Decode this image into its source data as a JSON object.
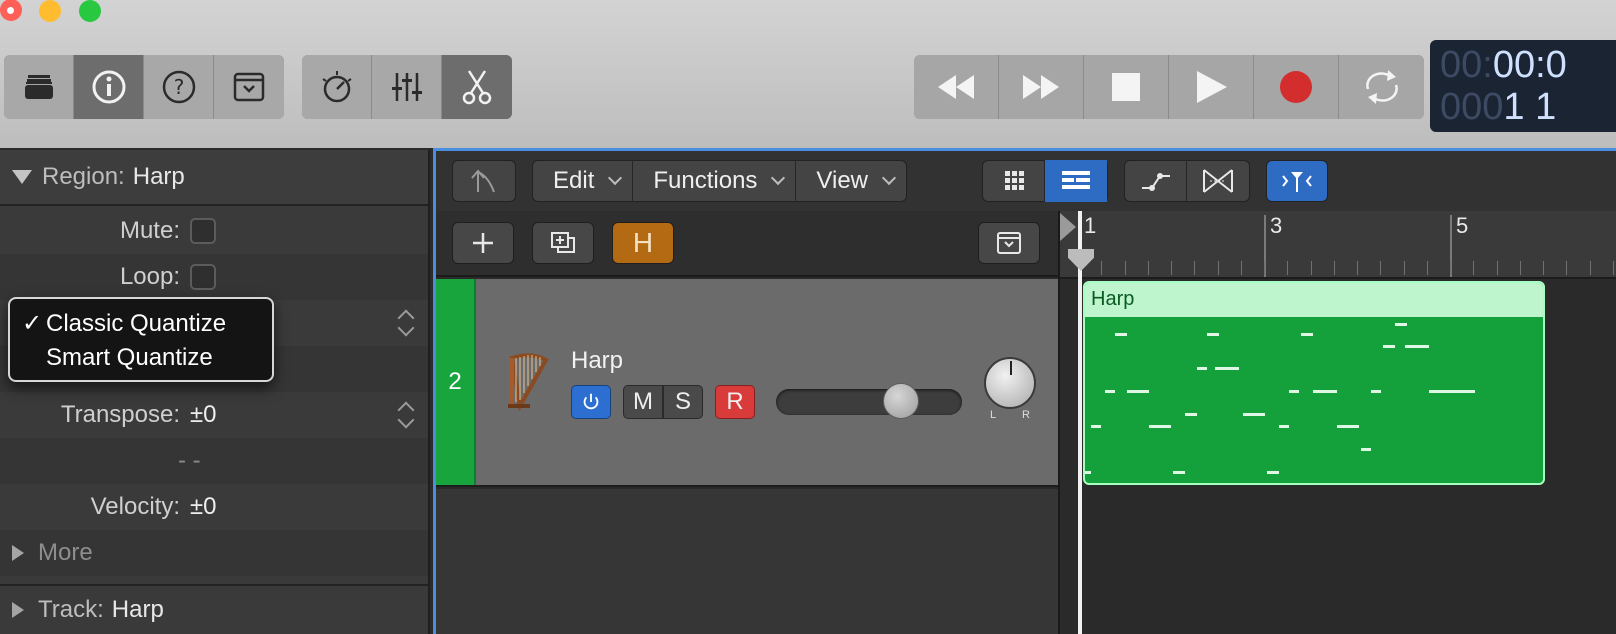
{
  "toolbar": {
    "left_group": [
      "library-icon",
      "inspector-icon",
      "quick-help-icon",
      "toolbar-icon"
    ],
    "mid_group": [
      "smart-controls-icon",
      "mixer-icon",
      "editors-icon"
    ],
    "transport": [
      "rewind-icon",
      "fast-forward-icon",
      "stop-icon",
      "play-icon",
      "record-icon",
      "cycle-icon"
    ],
    "lcd": {
      "time_dim": "00:",
      "time": "00:0",
      "bars_dim": "000",
      "bars": "1  1"
    }
  },
  "inspector": {
    "region_label": "Region:",
    "region_name": "Harp",
    "mute_label": "Mute:",
    "loop_label": "Loop:",
    "quantize_menu": {
      "items": [
        "Classic Quantize",
        "Smart Quantize"
      ],
      "checkmark": "✓"
    },
    "transpose_label": "Transpose:",
    "transpose_value": "±0",
    "fine_value": "- -",
    "velocity_label": "Velocity:",
    "velocity_value": "±0",
    "more_label": "More",
    "track_label": "Track:",
    "track_name": "Harp"
  },
  "tracks_toolbar": {
    "edit": "Edit",
    "functions": "Functions",
    "view": "View"
  },
  "track_header": {
    "h_button": "H"
  },
  "track": {
    "number": "2",
    "name": "Harp",
    "mute": "M",
    "solo": "S",
    "record": "R",
    "pan_l": "L",
    "pan_r": "R",
    "volume_level": 0.71
  },
  "ruler": {
    "bars": [
      "1",
      "3",
      "5"
    ]
  },
  "region": {
    "name": "Harp",
    "color": "#14a13b"
  }
}
